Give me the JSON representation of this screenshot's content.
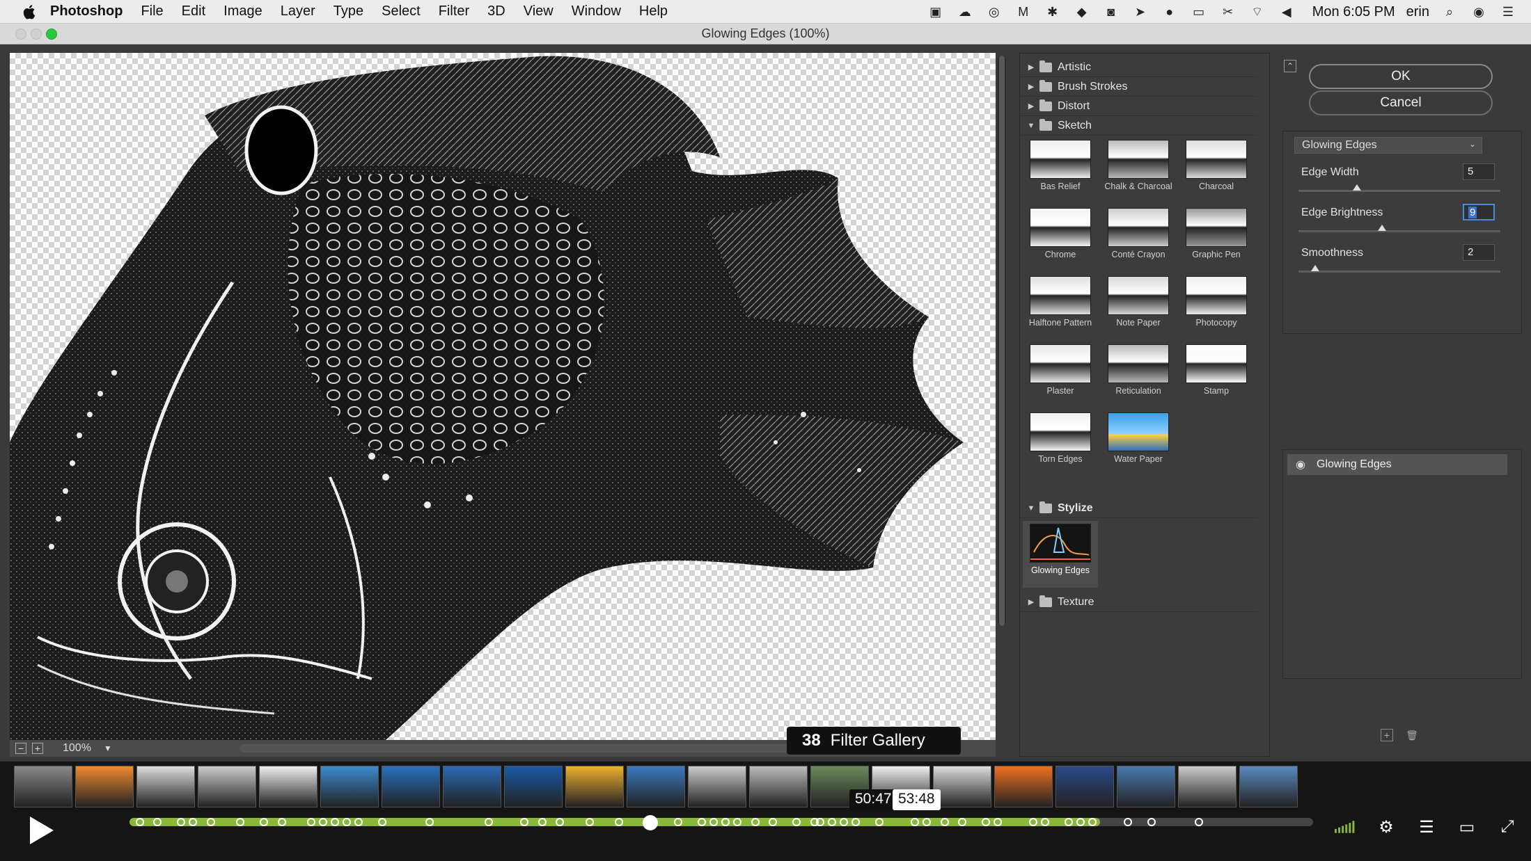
{
  "menubar": {
    "app_name": "Photoshop",
    "menus": [
      "File",
      "Edit",
      "Image",
      "Layer",
      "Type",
      "Select",
      "Filter",
      "3D",
      "View",
      "Window",
      "Help"
    ],
    "clock": "Mon 6:05 PM",
    "user": "erin"
  },
  "window": {
    "title": "Glowing Edges (100%)"
  },
  "preview": {
    "zoom": "100%"
  },
  "filter_tree": {
    "folders_top": [
      "Artistic",
      "Brush Strokes",
      "Distort"
    ],
    "sketch": {
      "label": "Sketch",
      "items": [
        "Bas Relief",
        "Chalk & Charcoal",
        "Charcoal",
        "Chrome",
        "Conté Crayon",
        "Graphic Pen",
        "Halftone Pattern",
        "Note Paper",
        "Photocopy",
        "Plaster",
        "Reticulation",
        "Stamp",
        "Torn Edges",
        "Water Paper"
      ]
    },
    "stylize": {
      "label": "Stylize",
      "items": [
        "Glowing Edges"
      ]
    },
    "folders_bottom": [
      "Texture"
    ]
  },
  "dialog": {
    "ok_label": "OK",
    "cancel_label": "Cancel",
    "selected_filter": "Glowing Edges",
    "params": [
      {
        "label": "Edge Width",
        "value": "5"
      },
      {
        "label": "Edge Brightness",
        "value": "9"
      },
      {
        "label": "Smoothness",
        "value": "2"
      }
    ],
    "layer_name": "Glowing Edges"
  },
  "player": {
    "chapter_number": "38",
    "chapter_title": "Filter Gallery",
    "hover_time": "50:47",
    "chapter_time": "53:48",
    "progress_fraction": 0.44
  },
  "colors": {
    "progress": "#8ab83d",
    "selection_blue": "#3b6fd0"
  }
}
